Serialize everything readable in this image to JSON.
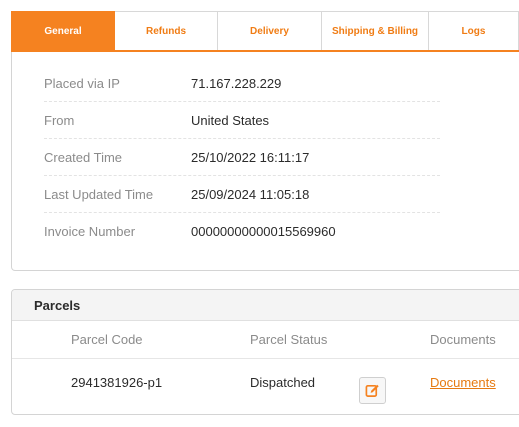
{
  "tabs": [
    "General",
    "Refunds",
    "Delivery",
    "Shipping & Billing",
    "Logs"
  ],
  "info": {
    "placed_ip": {
      "label": "Placed via IP",
      "value": "71.167.228.229"
    },
    "from": {
      "label": "From",
      "value": "United States"
    },
    "created": {
      "label": "Created Time",
      "value": "25/10/2022 16:11:17"
    },
    "updated": {
      "label": "Last Updated Time",
      "value": "25/09/2024 11:05:18"
    },
    "invoice": {
      "label": "Invoice Number",
      "value": "00000000000015569960"
    }
  },
  "parcels": {
    "title": "Parcels",
    "columns": {
      "code": "Parcel Code",
      "status": "Parcel Status",
      "documents": "Documents"
    },
    "rows": [
      {
        "code": "2941381926-p1",
        "status": "Dispatched",
        "documents": "Documents"
      }
    ]
  },
  "colors": {
    "accent": "#f58220",
    "link": "#e67a10"
  },
  "icons": {
    "edit": "edit-icon"
  }
}
